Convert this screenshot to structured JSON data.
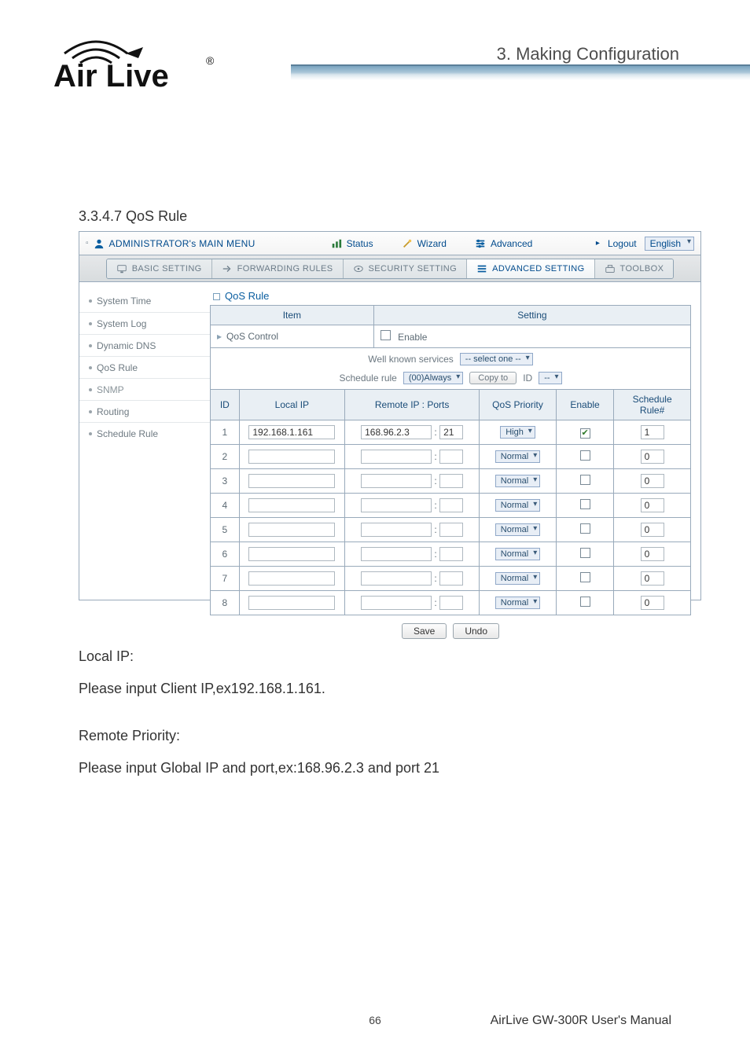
{
  "doc": {
    "chapter": "3.  Making  Configuration",
    "section_heading": "3.3.4.7 QoS Rule",
    "page_number": "66",
    "footer": "AirLive GW-300R User's Manual"
  },
  "logo": {
    "brand": "Air Live",
    "registered": "®"
  },
  "topbar": {
    "menu_title": "ADMINISTRATOR's MAIN MENU",
    "status": "Status",
    "wizard": "Wizard",
    "advanced": "Advanced",
    "logout": "Logout",
    "logout_arrow": "▸",
    "language": "English"
  },
  "navtabs": {
    "basic": "BASIC SETTING",
    "forwarding": "FORWARDING RULES",
    "security": "SECURITY SETTING",
    "advanced": "ADVANCED SETTING",
    "toolbox": "TOOLBOX"
  },
  "sidebar": {
    "items": [
      {
        "label": "System Time"
      },
      {
        "label": "System Log"
      },
      {
        "label": "Dynamic DNS"
      },
      {
        "label": "QoS Rule"
      },
      {
        "label": "SNMP"
      },
      {
        "label": "Routing"
      },
      {
        "label": "Schedule Rule"
      }
    ]
  },
  "panel": {
    "title": "QoS Rule",
    "head_item": "Item",
    "head_setting": "Setting",
    "qos_control_label": "QoS Control",
    "qos_control_sub": "▸",
    "enable_label": "Enable",
    "well_known_label": "Well known services",
    "well_known_value": "-- select one --",
    "schedule_label": "Schedule rule",
    "schedule_value": "(00)Always",
    "copy_to": "Copy to",
    "copy_id": "ID",
    "copy_sel": "--",
    "col_id": "ID",
    "col_local": "Local IP",
    "col_remote": "Remote IP : Ports",
    "col_priority": "QoS Priority",
    "col_enable": "Enable",
    "col_schedule_top": "Schedule",
    "col_schedule_bot": "Rule#",
    "save": "Save",
    "undo": "Undo"
  },
  "rows": [
    {
      "id": "1",
      "local": "192.168.1.161",
      "remote_ip": "168.96.2.3",
      "remote_port": "21",
      "priority": "High",
      "enabled": true,
      "rule": "1"
    },
    {
      "id": "2",
      "local": "",
      "remote_ip": "",
      "remote_port": "",
      "priority": "Normal",
      "enabled": false,
      "rule": "0"
    },
    {
      "id": "3",
      "local": "",
      "remote_ip": "",
      "remote_port": "",
      "priority": "Normal",
      "enabled": false,
      "rule": "0"
    },
    {
      "id": "4",
      "local": "",
      "remote_ip": "",
      "remote_port": "",
      "priority": "Normal",
      "enabled": false,
      "rule": "0"
    },
    {
      "id": "5",
      "local": "",
      "remote_ip": "",
      "remote_port": "",
      "priority": "Normal",
      "enabled": false,
      "rule": "0"
    },
    {
      "id": "6",
      "local": "",
      "remote_ip": "",
      "remote_port": "",
      "priority": "Normal",
      "enabled": false,
      "rule": "0"
    },
    {
      "id": "7",
      "local": "",
      "remote_ip": "",
      "remote_port": "",
      "priority": "Normal",
      "enabled": false,
      "rule": "0"
    },
    {
      "id": "8",
      "local": "",
      "remote_ip": "",
      "remote_port": "",
      "priority": "Normal",
      "enabled": false,
      "rule": "0"
    }
  ],
  "body": {
    "local_ip_h": "Local IP:",
    "local_ip_p": "Please input Client IP,ex192.168.1.161.",
    "remote_h": "Remote Priority:",
    "remote_p": "Please input Global IP and port,ex:168.96.2.3 and port 21"
  }
}
